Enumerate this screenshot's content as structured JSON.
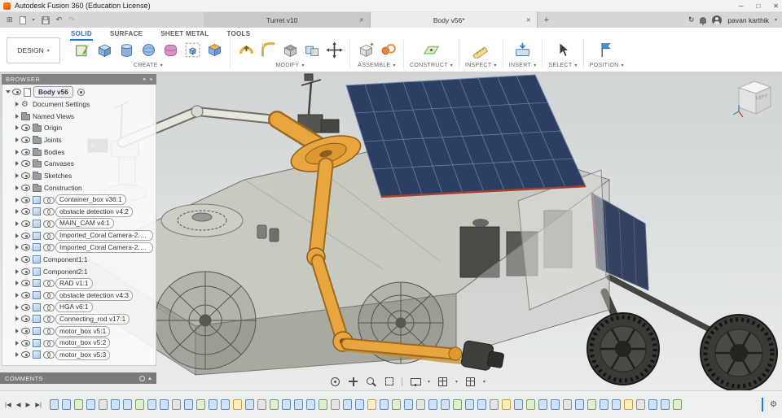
{
  "titlebar": {
    "app_title": "Autodesk Fusion 360 (Education License)"
  },
  "glyphs": {
    "app_menu": "⊞",
    "caret": "▾",
    "undo": "↶",
    "redo": "↷",
    "tab_close": "✕",
    "new_tab": "+",
    "job_status": "↻",
    "minimize": "─",
    "maximize": "□",
    "close": "✕",
    "browser_collapse": "◂",
    "browser_dot": "●",
    "comments_expand": "▴",
    "skip_start": "|◀",
    "step_back": "◀",
    "play": "▶",
    "skip_end": "▶|",
    "gear": "⚙"
  },
  "tabbar": {
    "doc_tabs": [
      {
        "label": "Turret v10"
      },
      {
        "label": "Body v56*"
      }
    ],
    "user_name": "pavan karthik"
  },
  "ribbon": {
    "design_label": "DESIGN",
    "env_tabs": [
      {
        "label": "SOLID"
      },
      {
        "label": "SURFACE"
      },
      {
        "label": "SHEET METAL"
      },
      {
        "label": "TOOLS"
      }
    ],
    "groups": [
      {
        "label": "CREATE"
      },
      {
        "label": "MODIFY"
      },
      {
        "label": "ASSEMBLE"
      },
      {
        "label": "CONSTRUCT"
      },
      {
        "label": "INSPECT"
      },
      {
        "label": "INSERT"
      },
      {
        "label": "SELECT"
      },
      {
        "label": "POSITION"
      }
    ]
  },
  "browser": {
    "title": "BROWSER",
    "root_label": "Body v56",
    "items": [
      {
        "label": "Document Settings",
        "kind": "gear",
        "eye": false,
        "link": false,
        "cls": ""
      },
      {
        "label": "Named Views",
        "kind": "folder",
        "eye": false,
        "link": false,
        "cls": ""
      },
      {
        "label": "Origin",
        "kind": "folder",
        "eye": true,
        "link": false,
        "cls": ""
      },
      {
        "label": "Joints",
        "kind": "folder",
        "eye": true,
        "link": false,
        "cls": ""
      },
      {
        "label": "Bodies",
        "kind": "folder",
        "eye": true,
        "link": false,
        "cls": ""
      },
      {
        "label": "Canvases",
        "kind": "folder",
        "eye": true,
        "link": false,
        "cls": ""
      },
      {
        "label": "Sketches",
        "kind": "folder",
        "eye": true,
        "link": false,
        "cls": ""
      },
      {
        "label": "Construction",
        "kind": "folder",
        "eye": true,
        "link": false,
        "cls": ""
      },
      {
        "label": "Container_box v36:1",
        "kind": "component",
        "eye": true,
        "link": true,
        "cls": "bubble"
      },
      {
        "label": "obstacle detection v4:2",
        "kind": "component",
        "eye": true,
        "link": true,
        "cls": "bubble"
      },
      {
        "label": "MAIN_CAM v4:1",
        "kind": "component",
        "eye": true,
        "link": true,
        "cls": "bubble"
      },
      {
        "label": "Imported_Coral Camera-2.0 v...",
        "kind": "component",
        "eye": true,
        "link": true,
        "cls": "bubble"
      },
      {
        "label": "Imported_Coral Camera-2.0 v...",
        "kind": "component",
        "eye": true,
        "link": true,
        "cls": "bubble"
      },
      {
        "label": "Component1:1",
        "kind": "component",
        "eye": true,
        "link": false,
        "cls": ""
      },
      {
        "label": "Component2:1",
        "kind": "component",
        "eye": true,
        "link": false,
        "cls": ""
      },
      {
        "label": "RAD v1:1",
        "kind": "component",
        "eye": true,
        "link": true,
        "cls": "bubble"
      },
      {
        "label": "obstacle detection v4:3",
        "kind": "component",
        "eye": true,
        "link": true,
        "cls": "bubble"
      },
      {
        "label": "HGA v6:1",
        "kind": "component",
        "eye": true,
        "link": true,
        "cls": "bubble"
      },
      {
        "label": "Connecting_rod v17:1",
        "kind": "component",
        "eye": true,
        "link": true,
        "cls": "bubble"
      },
      {
        "label": "motor_box v5:1",
        "kind": "component",
        "eye": true,
        "link": true,
        "cls": "bubble"
      },
      {
        "label": "motor_box v5:2",
        "kind": "component",
        "eye": true,
        "link": true,
        "cls": "bubble"
      },
      {
        "label": "motor_box v5:3",
        "kind": "component",
        "eye": true,
        "link": true,
        "cls": "bubble"
      }
    ]
  },
  "comments": {
    "title": "COMMENTS"
  },
  "viewcube": {
    "face_label": "LEFT"
  },
  "timeline": {
    "icons": [
      "c",
      "c",
      "s",
      "c",
      "j",
      "c",
      "c",
      "s",
      "c",
      "c",
      "j",
      "c",
      "s",
      "c",
      "c",
      "g",
      "c",
      "j",
      "s",
      "c",
      "c",
      "c",
      "s",
      "j",
      "c",
      "c",
      "g",
      "c",
      "s",
      "c",
      "j",
      "c",
      "c",
      "s",
      "c",
      "c",
      "j",
      "g",
      "c",
      "s",
      "c",
      "c",
      "j",
      "c",
      "s",
      "c",
      "c",
      "g",
      "j",
      "c",
      "c",
      "s"
    ]
  },
  "colors": {
    "accent_blue": "#1f6fd8",
    "arm_orange": "#e9a63e",
    "solar_panel_blue": "#2d3e63"
  }
}
